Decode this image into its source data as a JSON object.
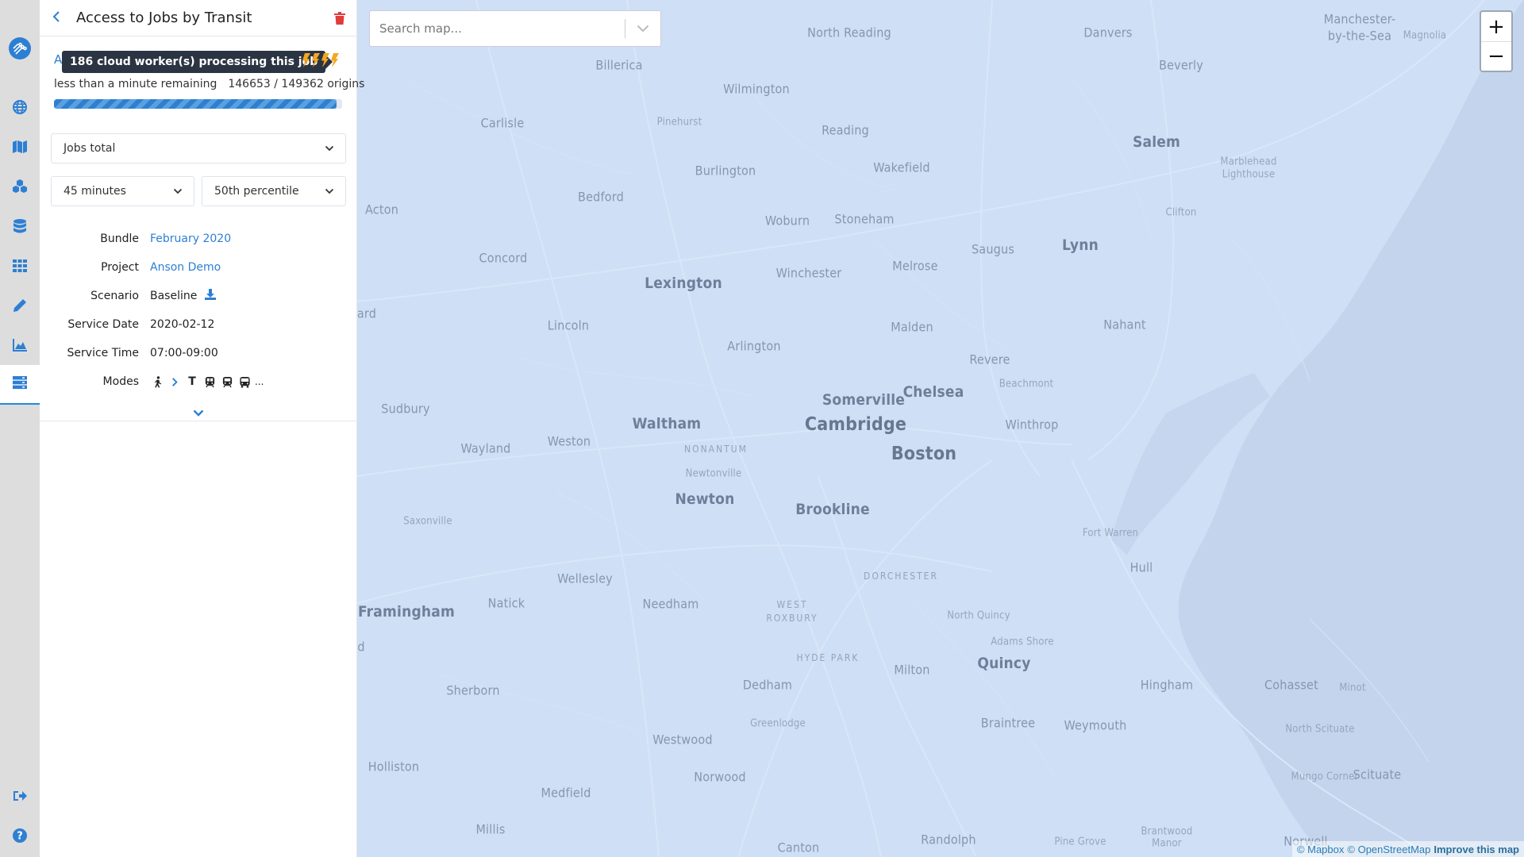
{
  "sidebar": {
    "items": [
      {
        "name": "globe-icon",
        "label": "Regions"
      },
      {
        "name": "map-icon",
        "label": "Maps"
      },
      {
        "name": "cubes-icon",
        "label": "Modifications"
      },
      {
        "name": "database-icon",
        "label": "Data"
      },
      {
        "name": "grid-icon",
        "label": "Grid"
      },
      {
        "name": "pencil-icon",
        "label": "Edit"
      },
      {
        "name": "area-chart-icon",
        "label": "Analysis"
      },
      {
        "name": "server-icon",
        "label": "Jobs",
        "active": true
      }
    ],
    "bottom": [
      {
        "name": "sign-out-icon",
        "label": "Log out"
      },
      {
        "name": "help-icon",
        "label": "Help"
      }
    ]
  },
  "panel": {
    "title": "Access to Jobs by Transit",
    "status_first_letter": "A",
    "tooltip": "186 cloud worker(s) processing this job",
    "workers_bolts": 4,
    "time_remaining": "less than a minute remaining",
    "origins_progress": "146653 / 149362 origins",
    "progress_complete": 146653,
    "progress_total": 149362,
    "opportunity_select": "Jobs total",
    "time_cutoff_select": "45 minutes",
    "percentile_select": "50th percentile",
    "info": {
      "bundle_label": "Bundle",
      "bundle_value": "February 2020",
      "project_label": "Project",
      "project_value": "Anson Demo",
      "scenario_label": "Scenario",
      "scenario_value": "Baseline",
      "service_date_label": "Service Date",
      "service_date_value": "2020-02-12",
      "service_time_label": "Service Time",
      "service_time_value": "07:00-09:00",
      "modes_label": "Modes",
      "modes": [
        "walk",
        "then",
        "tram",
        "subway",
        "rail",
        "bus"
      ],
      "modes_more": "...",
      "tram_letter": "T"
    }
  },
  "map": {
    "search_placeholder": "Search map...",
    "zoom_in": "+",
    "zoom_out": "−",
    "attribution": {
      "mapbox": "© Mapbox",
      "osm": "© OpenStreetMap",
      "improve": "Improve this map"
    },
    "labels": [
      "North Reading",
      "Danvers",
      "Manchester-",
      "by-the-Sea",
      "Magnolia",
      "Billerica",
      "Wilmington",
      "Beverly",
      "Carlisle",
      "Pinehurst",
      "Reading",
      "Salem",
      "Marblehead",
      "Lighthouse",
      "Burlington",
      "Wakefield",
      "Bedford",
      "Acton",
      "Woburn",
      "Stoneham",
      "Clifton",
      "Saugus",
      "Lynn",
      "Concord",
      "Lexington",
      "Winchester",
      "Melrose",
      "ard",
      "Lincoln",
      "Malden",
      "Nahant",
      "Arlington",
      "Revere",
      "Beachmont",
      "Sudbury",
      "Somerville",
      "Chelsea",
      "Waltham",
      "Cambridge",
      "Winthrop",
      "Boston",
      "Weston",
      "Wayland",
      "Nonantum",
      "Newtonville",
      "Newton",
      "Brookline",
      "Saxonville",
      "Fort Warren",
      "Hull",
      "Wellesley",
      "Dorchester",
      "Natick",
      "Needham",
      "Framingham",
      "West",
      "Roxbury",
      "North Quincy",
      "Adams Shore",
      "Hyde Park",
      "Quincy",
      "Milton",
      "Dedham",
      "Hingham",
      "Cohasset",
      "Minot",
      "Sherborn",
      "Greenlodge",
      "Braintree",
      "Weymouth",
      "North Scituate",
      "Westwood",
      "Holliston",
      "Norwood",
      "Mungo Corner",
      "Scituate",
      "Medfield",
      "Millis",
      "Randolph",
      "Canton",
      "Pine Grove",
      "Brantwood",
      "Manor",
      "Norwell",
      "d"
    ]
  },
  "colors": {
    "accent": "#2d7fd3",
    "danger": "#e03c3c",
    "bolt": "#f5a623",
    "land": "#cfdff5",
    "water": "#c3d4ec",
    "tooltip_bg": "#2b3442"
  }
}
